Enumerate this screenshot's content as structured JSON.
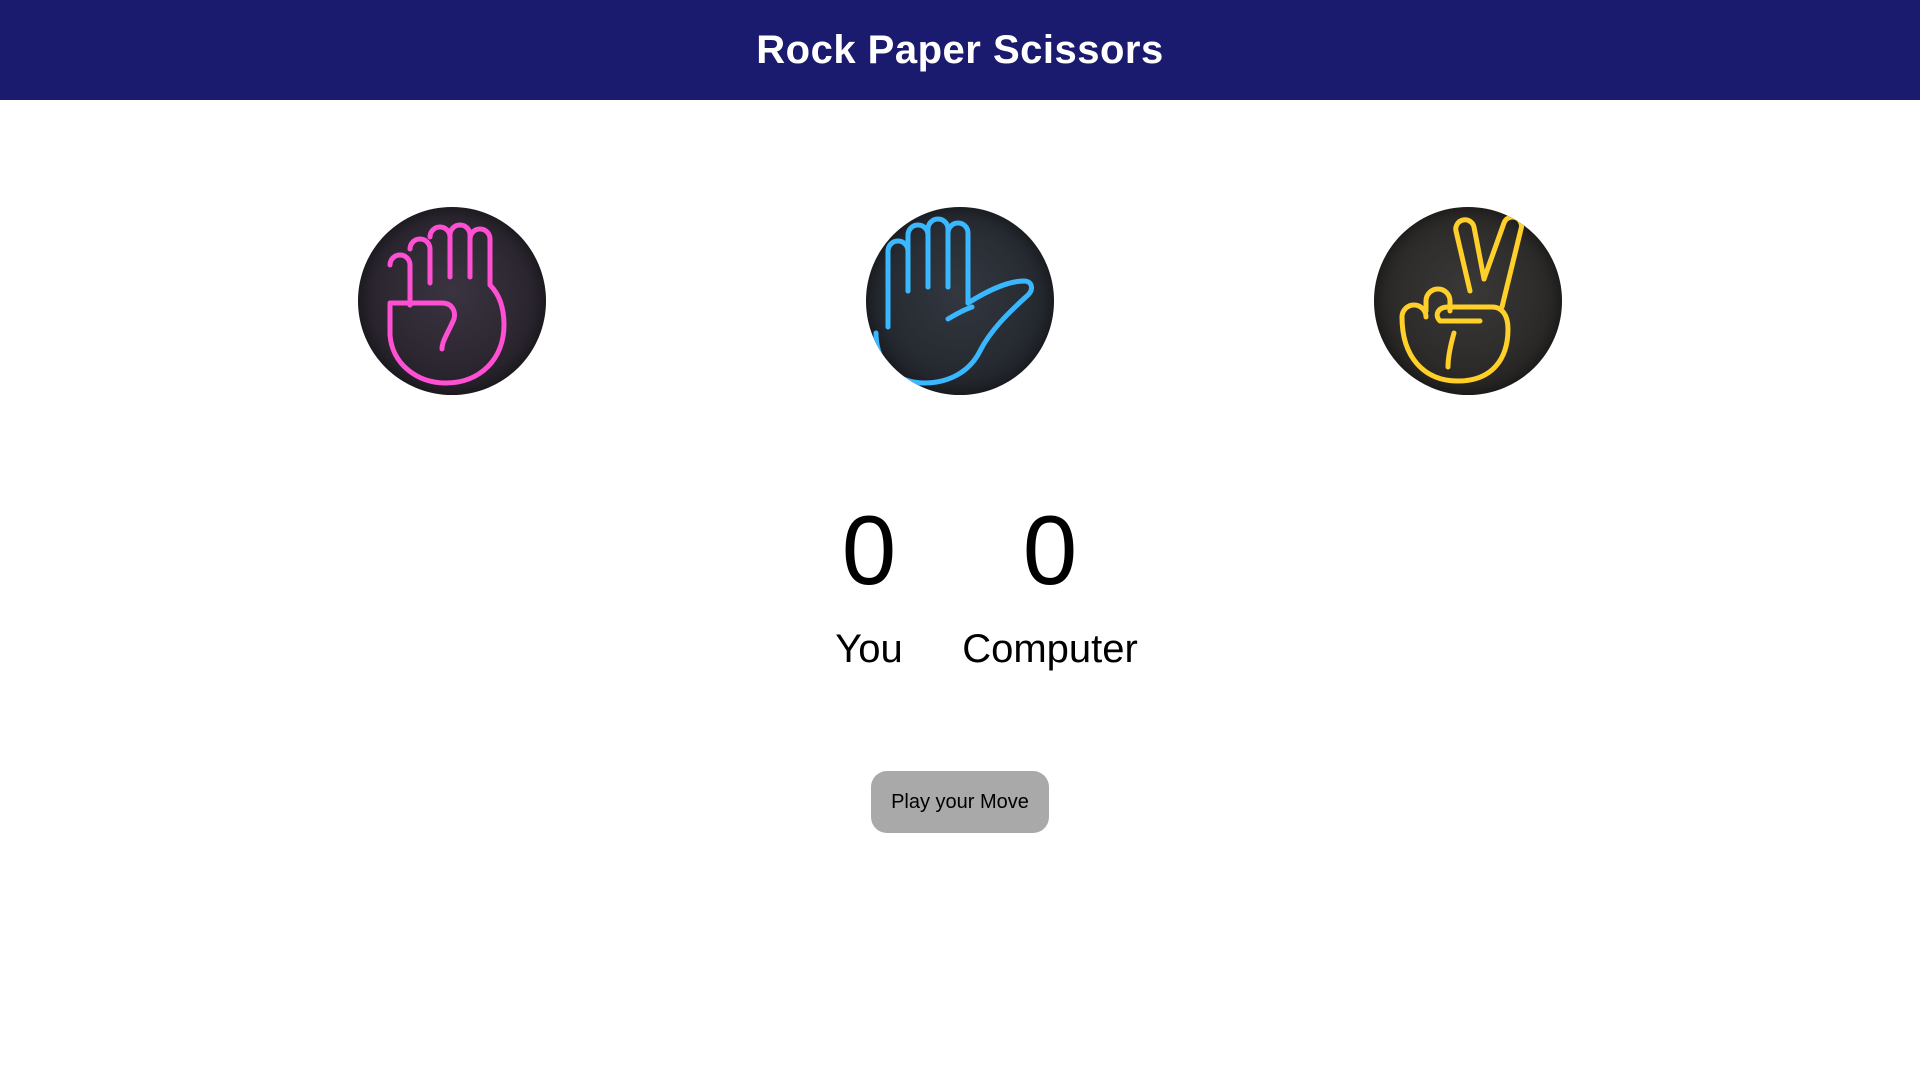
{
  "header": {
    "title": "Rock Paper Scissors"
  },
  "choices": [
    {
      "id": "rock",
      "icon": "fist-icon",
      "color": "#ff4fd2"
    },
    {
      "id": "paper",
      "icon": "open-hand-icon",
      "color": "#3ab8ff"
    },
    {
      "id": "scissors",
      "icon": "peace-hand-icon",
      "color": "#ffcf2a"
    }
  ],
  "score": {
    "user": {
      "value": "0",
      "label": "You"
    },
    "computer": {
      "value": "0",
      "label": "Computer"
    }
  },
  "message": {
    "text": "Play your Move",
    "background": "#a9a9a9"
  },
  "colors": {
    "header_bg": "#1a1a6e",
    "header_text": "#ffffff"
  }
}
